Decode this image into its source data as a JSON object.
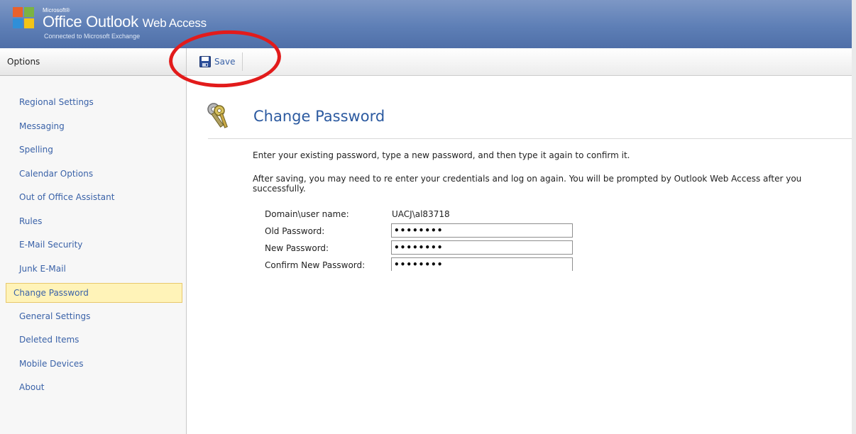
{
  "banner": {
    "brand_small": "Microsoft®",
    "brand_product": "Office Outlook",
    "brand_suffix": "Web Access",
    "subtitle": "Connected to Microsoft Exchange"
  },
  "sidebar": {
    "header": "Options",
    "items": [
      {
        "label": "Regional Settings"
      },
      {
        "label": "Messaging"
      },
      {
        "label": "Spelling"
      },
      {
        "label": "Calendar Options"
      },
      {
        "label": "Out of Office Assistant"
      },
      {
        "label": "Rules"
      },
      {
        "label": "E-Mail Security"
      },
      {
        "label": "Junk E-Mail"
      },
      {
        "label": "Change Password",
        "selected": true
      },
      {
        "label": "General Settings"
      },
      {
        "label": "Deleted Items"
      },
      {
        "label": "Mobile Devices"
      },
      {
        "label": "About"
      }
    ]
  },
  "toolbar": {
    "save_label": "Save",
    "save_icon": "floppy-disk-icon"
  },
  "main": {
    "title": "Change Password",
    "title_icon": "keys-icon",
    "instruction_1": "Enter your existing password, type a new password, and then type it again to confirm it.",
    "instruction_2_line1": "After saving, you may need to re enter your credentials and log on again. You will be prompted by Outlook Web Access after you",
    "instruction_2_line2": "successfully.",
    "form": {
      "username_label": "Domain\\user name:",
      "username_value": "UACJ\\al83718",
      "old_password_label": "Old Password:",
      "old_password_value": "••••••••",
      "new_password_label": "New Password:",
      "new_password_value": "••••••••",
      "confirm_password_label": "Confirm New Password:",
      "confirm_password_value": "••••••••"
    }
  },
  "colors": {
    "link_blue": "#3a62a8",
    "title_blue": "#2c5aa0",
    "banner_blue": "#5e7fb6",
    "selected_bg": "#fff3b8",
    "annotation_red": "#e21b1b"
  }
}
